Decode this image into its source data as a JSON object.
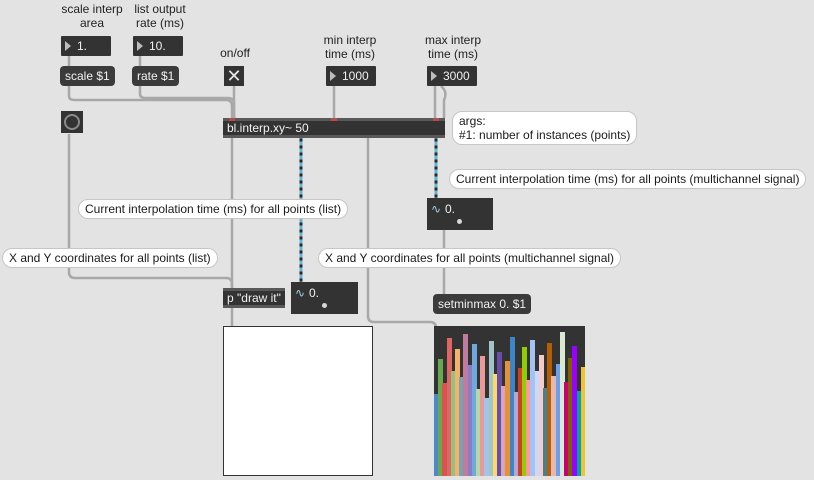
{
  "labels": {
    "scale_interp": "scale interp\narea",
    "list_output": "list output\nrate (ms)",
    "on_off": "on/off",
    "min_interp": "min interp\ntime (ms)",
    "max_interp": "max interp\ntime (ms)"
  },
  "number_boxes": {
    "scale": "1.",
    "rate": "10.",
    "min": "1000",
    "max": "3000"
  },
  "messages": {
    "scale": "scale $1",
    "rate": "rate $1",
    "setminmax": "setminmax 0. $1"
  },
  "objects": {
    "interp": "bl.interp.xy~ 50",
    "draw": "p \"draw it\""
  },
  "toggle_glyph": "✕",
  "signal_displays": {
    "interp_time": {
      "wave": "∿",
      "value": "0."
    },
    "xy": {
      "wave": "∿",
      "value": "0."
    }
  },
  "comments": {
    "args_line1": "args:",
    "args_line2": "#1: number of instances (points)",
    "interp_time_signal": "Current interpolation time (ms) for all points (multichannel signal)",
    "interp_time_list": "Current interpolation time (ms) for all points (list)",
    "xy_list": "X and Y coordinates for all points (list)",
    "xy_signal": "X and Y coordinates for all points (multichannel signal)"
  },
  "multislider": {
    "bars": [
      {
        "value": 0.55,
        "color": "#4d88c9"
      },
      {
        "value": 0.78,
        "color": "#6aa84f"
      },
      {
        "value": 0.62,
        "color": "#d9534f"
      },
      {
        "value": 0.92,
        "color": "#e06666"
      },
      {
        "value": 0.7,
        "color": "#93c47d"
      },
      {
        "value": 0.85,
        "color": "#f6b26b"
      },
      {
        "value": 0.66,
        "color": "#76a5af"
      },
      {
        "value": 0.95,
        "color": "#c27ba0"
      },
      {
        "value": 0.74,
        "color": "#8e7cc3"
      },
      {
        "value": 0.88,
        "color": "#6fa8dc"
      },
      {
        "value": 0.58,
        "color": "#b6d7a8"
      },
      {
        "value": 0.8,
        "color": "#ea9999"
      },
      {
        "value": 0.52,
        "color": "#9fc5e8"
      },
      {
        "value": 0.9,
        "color": "#a2c4c9"
      },
      {
        "value": 0.68,
        "color": "#ffd966"
      },
      {
        "value": 0.83,
        "color": "#674ea7"
      },
      {
        "value": 0.6,
        "color": "#d5a6bd"
      },
      {
        "value": 0.77,
        "color": "#e69138"
      },
      {
        "value": 0.93,
        "color": "#3d85c6"
      },
      {
        "value": 0.56,
        "color": "#b4a7d6"
      },
      {
        "value": 0.72,
        "color": "#cc4125"
      },
      {
        "value": 0.86,
        "color": "#8fce00"
      },
      {
        "value": 0.64,
        "color": "#ff9999"
      },
      {
        "value": 0.91,
        "color": "#a4c2f4"
      },
      {
        "value": 0.7,
        "color": "#c9daf8"
      },
      {
        "value": 0.81,
        "color": "#f4cccc"
      },
      {
        "value": 0.59,
        "color": "#45818e"
      },
      {
        "value": 0.89,
        "color": "#b45f06"
      },
      {
        "value": 0.67,
        "color": "#e6b8af"
      },
      {
        "value": 0.75,
        "color": "#6d9eeb"
      },
      {
        "value": 0.96,
        "color": "#d9ead3"
      },
      {
        "value": 0.63,
        "color": "#c90076"
      },
      {
        "value": 0.79,
        "color": "#7f6000"
      },
      {
        "value": 0.87,
        "color": "#9900ff"
      },
      {
        "value": 0.57,
        "color": "#00a3a3"
      },
      {
        "value": 0.73,
        "color": "#f1c232"
      }
    ]
  }
}
